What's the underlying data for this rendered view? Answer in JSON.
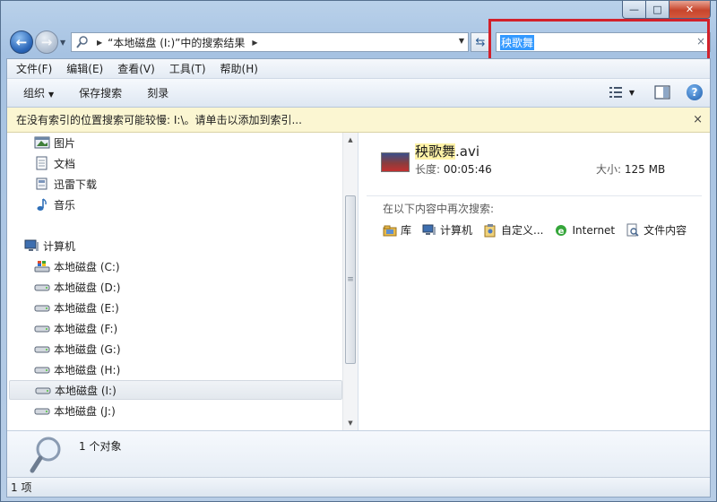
{
  "window": {
    "caption_minimize": "—",
    "caption_maximize": "□",
    "caption_close": "✕"
  },
  "nav": {
    "back": "←",
    "forward": "→",
    "address_text": "“本地磁盘 (I:)”中的搜索结果",
    "refresh": "⇆"
  },
  "search": {
    "value": "秧歌舞",
    "clear": "×"
  },
  "menu": {
    "items": [
      "文件(F)",
      "编辑(E)",
      "查看(V)",
      "工具(T)",
      "帮助(H)"
    ]
  },
  "toolbar": {
    "organize": "组织",
    "save_search": "保存搜索",
    "burn": "刻录",
    "help": "?"
  },
  "infobar": {
    "text": "在没有索引的位置搜索可能较慢: I:\\。请单击以添加到索引...",
    "close": "×"
  },
  "sidebar": {
    "libraries": [
      {
        "label": "图片",
        "icon": "pictures-icon"
      },
      {
        "label": "文档",
        "icon": "documents-icon"
      },
      {
        "label": "迅雷下载",
        "icon": "download-folder-icon"
      },
      {
        "label": "音乐",
        "icon": "music-icon"
      }
    ],
    "computer": "计算机",
    "drives": [
      "本地磁盘 (C:)",
      "本地磁盘 (D:)",
      "本地磁盘 (E:)",
      "本地磁盘 (F:)",
      "本地磁盘 (G:)",
      "本地磁盘 (H:)",
      "本地磁盘 (I:)",
      "本地磁盘 (J:)"
    ],
    "selected_drive": "本地磁盘 (I:)"
  },
  "result": {
    "name_match": "秧歌舞",
    "name_ext": ".avi",
    "length_label": "长度:",
    "length_value": "00:05:46",
    "size_label": "大小:",
    "size_value": "125 MB"
  },
  "search_again": {
    "title": "在以下内容中再次搜索:",
    "links": [
      "库",
      "计算机",
      "自定义...",
      "Internet",
      "文件内容"
    ]
  },
  "details": {
    "count_text": "1 个对象"
  },
  "status": {
    "text": "1 项"
  }
}
